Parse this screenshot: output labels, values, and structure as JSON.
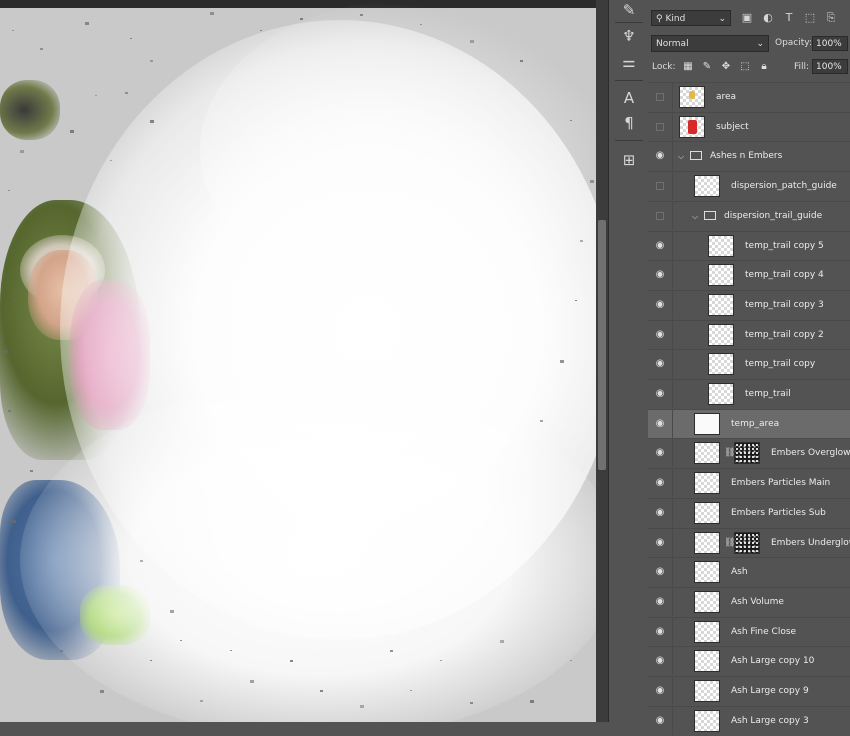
{
  "canvas": {
    "background": "#c9c9c9"
  },
  "tools": {
    "items": [
      "brush-tool-icon",
      "adjust-icon",
      "type-tool-icon",
      "paragraph-icon",
      "align-icon"
    ]
  },
  "layers_panel": {
    "filter_kind": "Kind",
    "blend_mode": "Normal",
    "opacity_label": "Opacity:",
    "opacity_value": "100%",
    "lock_label": "Lock:",
    "fill_label": "Fill:",
    "fill_value": "100%",
    "layers": [
      {
        "name": "area",
        "visible": false,
        "type": "layer",
        "indent": 0
      },
      {
        "name": "subject",
        "visible": false,
        "type": "layer",
        "indent": 0
      },
      {
        "name": "Ashes n Embers",
        "visible": true,
        "type": "group",
        "indent": 0
      },
      {
        "name": "dispersion_patch_guide",
        "visible": false,
        "type": "layer",
        "indent": 1
      },
      {
        "name": "dispersion_trail_guide",
        "visible": false,
        "type": "group",
        "indent": 1
      },
      {
        "name": "temp_trail copy 5",
        "visible": true,
        "type": "layer",
        "indent": 2
      },
      {
        "name": "temp_trail copy 4",
        "visible": true,
        "type": "layer",
        "indent": 2
      },
      {
        "name": "temp_trail copy 3",
        "visible": true,
        "type": "layer",
        "indent": 2
      },
      {
        "name": "temp_trail copy 2",
        "visible": true,
        "type": "layer",
        "indent": 2
      },
      {
        "name": "temp_trail copy",
        "visible": true,
        "type": "layer",
        "indent": 2
      },
      {
        "name": "temp_trail",
        "visible": true,
        "type": "layer",
        "indent": 2
      },
      {
        "name": "temp_area",
        "visible": true,
        "type": "layer",
        "indent": 1,
        "selected": true
      },
      {
        "name": "Embers Overglow",
        "visible": true,
        "type": "masked",
        "indent": 1
      },
      {
        "name": "Embers Particles Main",
        "visible": true,
        "type": "layer",
        "indent": 1
      },
      {
        "name": "Embers Particles Sub",
        "visible": true,
        "type": "layer",
        "indent": 1
      },
      {
        "name": "Embers Underglow",
        "visible": true,
        "type": "masked",
        "indent": 1
      },
      {
        "name": "Ash",
        "visible": true,
        "type": "layer",
        "indent": 1
      },
      {
        "name": "Ash Volume",
        "visible": true,
        "type": "layer",
        "indent": 1
      },
      {
        "name": "Ash Fine Close",
        "visible": true,
        "type": "layer",
        "indent": 1
      },
      {
        "name": "Ash Large copy 10",
        "visible": true,
        "type": "layer",
        "indent": 1
      },
      {
        "name": "Ash Large copy 9",
        "visible": true,
        "type": "layer",
        "indent": 1
      },
      {
        "name": "Ash Large copy 3",
        "visible": true,
        "type": "layer",
        "indent": 1
      }
    ]
  }
}
